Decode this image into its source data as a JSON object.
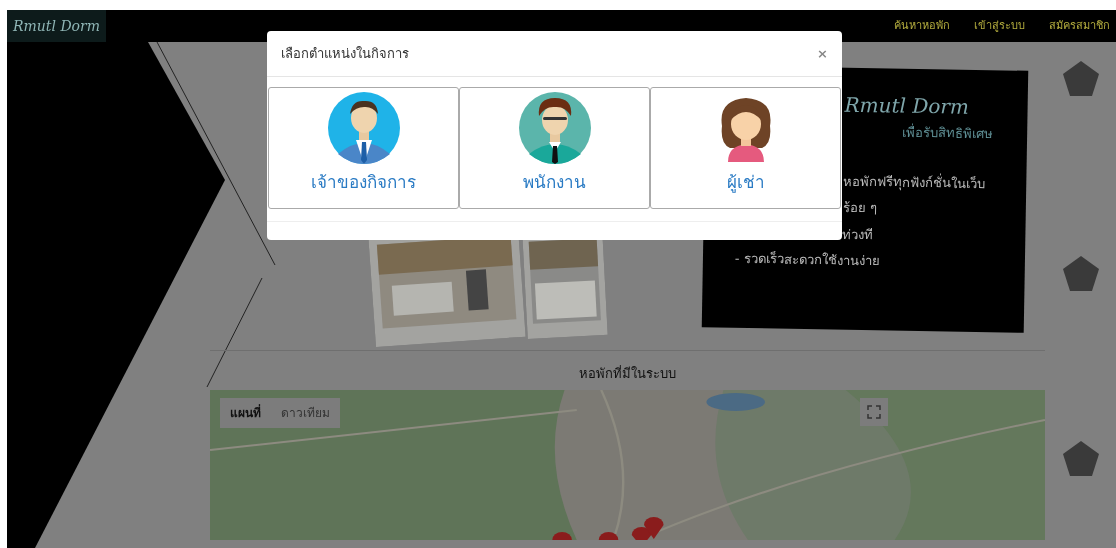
{
  "navbar": {
    "logo": "Rmutl Dorm",
    "links": [
      {
        "label": "ค้นหาหอพัก"
      },
      {
        "label": "เข้าสู่ระบบ"
      },
      {
        "label": "สมัครสมาชิก"
      }
    ]
  },
  "promo_card": {
    "title": "Rmutl Dorm",
    "subtitle": "เพื่อรับสิทธิพิเศษ",
    "lines": [
      "หอพักฟรีทุกฟังก์ชั่นในเว็บ",
      "ร้อย ๆ",
      "ท่วงที",
      "- รวดเร็วสะดวกใช้งานง่าย"
    ]
  },
  "map_section": {
    "heading": "หอพักที่มีในระบบ",
    "map_types": [
      {
        "label": "แผนที่",
        "selected": true
      },
      {
        "label": "ดาวเทียม",
        "selected": false
      }
    ]
  },
  "modal": {
    "title": "เลือกตำแหน่งในกิจการ",
    "close": "×",
    "roles": [
      {
        "kind": "owner",
        "label": "เจ้าของกิจการ"
      },
      {
        "kind": "staff",
        "label": "พนักงาน"
      },
      {
        "kind": "tenant",
        "label": "ผู้เช่า"
      }
    ]
  }
}
